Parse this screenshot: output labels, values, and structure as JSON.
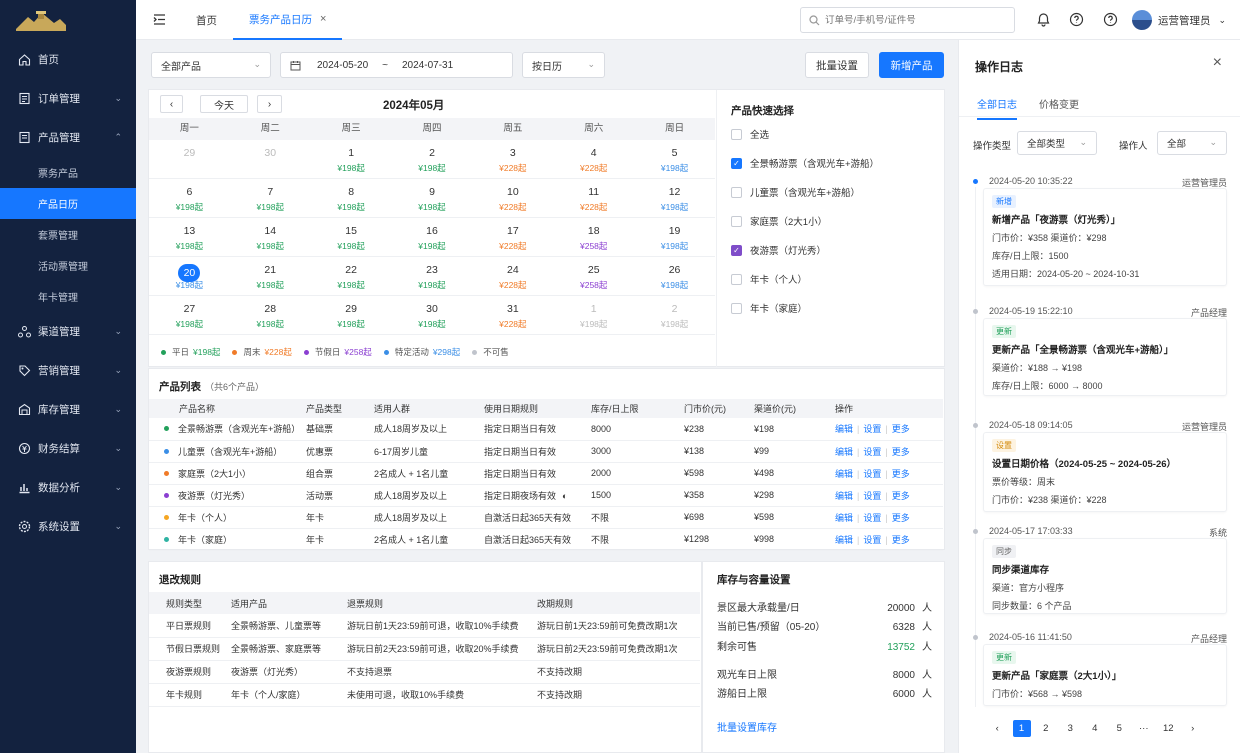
{
  "colors": {
    "accent": "#1677ff",
    "weekday": "#22a05b",
    "weekend": "#f07b28",
    "holiday": "#8b3fd1",
    "special": "#3a8ee6",
    "sidebar": "#13223f"
  },
  "sidebar": {
    "items": [
      {
        "label": "首页",
        "icon": "home-icon"
      },
      {
        "label": "订单管理",
        "icon": "order-icon"
      },
      {
        "label": "产品管理",
        "icon": "product-icon"
      }
    ],
    "sub": [
      "票务产品",
      "产品日历",
      "套票管理",
      "活动票管理",
      "年卡管理"
    ],
    "items2": [
      {
        "label": "渠道管理",
        "icon": "channel-icon"
      },
      {
        "label": "营销管理",
        "icon": "marketing-icon"
      },
      {
        "label": "库存管理",
        "icon": "inventory-icon"
      },
      {
        "label": "财务结算",
        "icon": "finance-icon"
      },
      {
        "label": "数据分析",
        "icon": "analytics-icon"
      },
      {
        "label": "系统设置",
        "icon": "settings-icon"
      }
    ]
  },
  "topbar": {
    "tab_home": "首页",
    "tab_active": "票务产品日历",
    "search_placeholder": "订单号/手机号/证件号",
    "user": "运营管理员"
  },
  "toolbar": {
    "product_select": "全部产品",
    "date_from": "2024-05-20",
    "date_sep": "~",
    "date_to": "2024-07-31",
    "view_select": "按日历",
    "batch": "批量设置",
    "add": "新增产品"
  },
  "calendar": {
    "today_btn": "今天",
    "month_title": "2024年05月",
    "weekdays": [
      "周一",
      "周二",
      "周三",
      "周四",
      "周五",
      "周六",
      "周日"
    ],
    "weeks": [
      [
        {
          "d": "29",
          "dim": true
        },
        {
          "d": "30",
          "dim": true
        },
        {
          "d": "1",
          "p": "¥198起",
          "t": "weekday"
        },
        {
          "d": "2",
          "p": "¥198起",
          "t": "weekday"
        },
        {
          "d": "3",
          "p": "¥228起",
          "t": "weekend"
        },
        {
          "d": "4",
          "p": "¥228起",
          "t": "weekend"
        },
        {
          "d": "5",
          "p": "¥198起",
          "t": "special"
        }
      ],
      [
        {
          "d": "6",
          "p": "¥198起",
          "t": "weekday"
        },
        {
          "d": "7",
          "p": "¥198起",
          "t": "weekday"
        },
        {
          "d": "8",
          "p": "¥198起",
          "t": "weekday"
        },
        {
          "d": "9",
          "p": "¥198起",
          "t": "weekday"
        },
        {
          "d": "10",
          "p": "¥228起",
          "t": "weekend"
        },
        {
          "d": "11",
          "p": "¥228起",
          "t": "weekend"
        },
        {
          "d": "12",
          "p": "¥198起",
          "t": "special"
        }
      ],
      [
        {
          "d": "13",
          "p": "¥198起",
          "t": "weekday"
        },
        {
          "d": "14",
          "p": "¥198起",
          "t": "weekday"
        },
        {
          "d": "15",
          "p": "¥198起",
          "t": "weekday"
        },
        {
          "d": "16",
          "p": "¥198起",
          "t": "weekday"
        },
        {
          "d": "17",
          "p": "¥228起",
          "t": "weekend"
        },
        {
          "d": "18",
          "p": "¥258起",
          "t": "holiday"
        },
        {
          "d": "19",
          "p": "¥198起",
          "t": "special"
        }
      ],
      [
        {
          "d": "20",
          "p": "¥198起",
          "t": "special",
          "today": true
        },
        {
          "d": "21",
          "p": "¥198起",
          "t": "weekday"
        },
        {
          "d": "22",
          "p": "¥198起",
          "t": "weekday"
        },
        {
          "d": "23",
          "p": "¥198起",
          "t": "weekday"
        },
        {
          "d": "24",
          "p": "¥228起",
          "t": "weekend"
        },
        {
          "d": "25",
          "p": "¥258起",
          "t": "holiday"
        },
        {
          "d": "26",
          "p": "¥198起",
          "t": "special"
        }
      ],
      [
        {
          "d": "27",
          "p": "¥198起",
          "t": "weekday"
        },
        {
          "d": "28",
          "p": "¥198起",
          "t": "weekday"
        },
        {
          "d": "29",
          "p": "¥198起",
          "t": "weekday"
        },
        {
          "d": "30",
          "p": "¥198起",
          "t": "weekday"
        },
        {
          "d": "31",
          "p": "¥228起",
          "t": "weekend"
        },
        {
          "d": "1",
          "p": "¥198起",
          "dim": true
        },
        {
          "d": "2",
          "p": "¥198起",
          "dim": true
        }
      ]
    ],
    "legend": [
      {
        "label": "平日",
        "price": "¥198起",
        "color": "#22a05b"
      },
      {
        "label": "周末",
        "price": "¥228起",
        "color": "#f07b28"
      },
      {
        "label": "节假日",
        "price": "¥258起",
        "color": "#8b3fd1"
      },
      {
        "label": "特定活动",
        "price": "¥298起",
        "color": "#3a8ee6"
      },
      {
        "label": "不可售",
        "price": "",
        "color": "#c0c4cc"
      }
    ]
  },
  "quick": {
    "title": "产品快速选择",
    "items": [
      {
        "label": "全选",
        "state": "off"
      },
      {
        "label": "全景畅游票（含观光车+游船）",
        "state": "on"
      },
      {
        "label": "儿童票（含观光车+游船）",
        "state": "off"
      },
      {
        "label": "家庭票（2大1小）",
        "state": "off"
      },
      {
        "label": "夜游票（灯光秀）",
        "state": "on2"
      },
      {
        "label": "年卡（个人）",
        "state": "off"
      },
      {
        "label": "年卡（家庭）",
        "state": "off"
      }
    ]
  },
  "products": {
    "title": "产品列表",
    "count": "（共6个产品）",
    "headers": [
      "产品名称",
      "产品类型",
      "适用人群",
      "使用日期规则",
      "库存/日上限",
      "门市价(元)",
      "渠道价(元)",
      "操作"
    ],
    "ops": [
      "编辑",
      "设置",
      "更多"
    ],
    "rows": [
      {
        "color": "#22a05b",
        "name": "全景畅游票（含观光车+游船）",
        "type": "基础票",
        "crowd": "成人18周岁及以上",
        "rule": "指定日期当日有效",
        "stock": "8000",
        "retail": "¥238",
        "channel": "¥198"
      },
      {
        "color": "#3a8ee6",
        "name": "儿童票（含观光车+游船）",
        "type": "优惠票",
        "crowd": "6-17周岁儿童",
        "rule": "指定日期当日有效",
        "stock": "3000",
        "retail": "¥138",
        "channel": "¥99"
      },
      {
        "color": "#f07b28",
        "name": "家庭票（2大1小）",
        "type": "组合票",
        "crowd": "2名成人 + 1名儿童",
        "rule": "指定日期当日有效",
        "stock": "2000",
        "retail": "¥598",
        "channel": "¥498"
      },
      {
        "color": "#8b3fd1",
        "name": "夜游票（灯光秀）",
        "type": "活动票",
        "crowd": "成人18周岁及以上",
        "rule": "指定日期夜场有效",
        "stock": "1500",
        "retail": "¥358",
        "channel": "¥298",
        "moon": true
      },
      {
        "color": "#f5a623",
        "name": "年卡（个人）",
        "type": "年卡",
        "crowd": "成人18周岁及以上",
        "rule": "自激活日起365天有效",
        "stock": "不限",
        "retail": "¥698",
        "channel": "¥598"
      },
      {
        "color": "#2fb3a3",
        "name": "年卡（家庭）",
        "type": "年卡",
        "crowd": "2名成人 + 1名儿童",
        "rule": "自激活日起365天有效",
        "stock": "不限",
        "retail": "¥1298",
        "channel": "¥998"
      }
    ]
  },
  "refund": {
    "title": "退改规则",
    "headers": [
      "规则类型",
      "适用产品",
      "退票规则",
      "改期规则"
    ],
    "rows": [
      [
        "平日票规则",
        "全景畅游票、儿童票等",
        "游玩日前1天23:59前可退，收取10%手续费",
        "游玩日前1天23:59前可免费改期1次"
      ],
      [
        "节假日票规则",
        "全景畅游票、家庭票等",
        "游玩日前2天23:59前可退，收取20%手续费",
        "游玩日前2天23:59前可免费改期1次"
      ],
      [
        "夜游票规则",
        "夜游票（灯光秀）",
        "不支持退票",
        "不支持改期"
      ],
      [
        "年卡规则",
        "年卡（个人/家庭）",
        "未使用可退，收取10%手续费",
        "不支持改期"
      ]
    ]
  },
  "inventory": {
    "title": "库存与容量设置",
    "link": "批量设置库存",
    "rows": [
      {
        "label": "景区最大承载量/日",
        "value": "20000",
        "unit": "人"
      },
      {
        "label": "当前已售/预留（05-20）",
        "value": "6328",
        "unit": "人"
      },
      {
        "label": "剩余可售",
        "value": "13752",
        "unit": "人",
        "green": true
      },
      {
        "label": "观光车日上限",
        "value": "8000",
        "unit": "人"
      },
      {
        "label": "游船日上限",
        "value": "6000",
        "unit": "人"
      }
    ]
  },
  "log": {
    "title": "操作日志",
    "tabs": [
      "全部日志",
      "价格变更"
    ],
    "type_label": "操作类型",
    "type_value": "全部类型",
    "op_label": "操作人",
    "op_value": "全部",
    "entries": [
      {
        "time": "2024-05-20 10:35:22",
        "who": "运营管理员",
        "badge": "新增",
        "bcolor": "#1677ff",
        "bbg": "#e8f1ff",
        "title": "新增产品「夜游票（灯光秀）」",
        "lines": [
          "门市价：¥358    渠道价：¥298",
          "库存/日上限：1500",
          "适用日期：2024-05-20 ~ 2024-10-31"
        ],
        "active": true
      },
      {
        "time": "2024-05-19 15:22:10",
        "who": "产品经理",
        "badge": "更新",
        "bcolor": "#22a05b",
        "bbg": "#e8f7ee",
        "title": "更新产品「全景畅游票（含观光车+游船）」",
        "lines": [
          "渠道价：¥188 → ¥198",
          "库存/日上限：6000 → 8000"
        ]
      },
      {
        "time": "2024-05-18 09:14:05",
        "who": "运营管理员",
        "badge": "设置",
        "bcolor": "#d48a0b",
        "bbg": "#fdf3e1",
        "title": "设置日期价格（2024-05-25 ~ 2024-05-26）",
        "lines": [
          "票价等级：周末",
          "门市价：¥238    渠道价：¥228"
        ]
      },
      {
        "time": "2024-05-17 17:03:33",
        "who": "系统",
        "badge": "同步",
        "bcolor": "#666",
        "bbg": "#f0f1f4",
        "title": "同步渠道库存",
        "lines": [
          "渠道：官方小程序",
          "同步数量：6 个产品"
        ]
      },
      {
        "time": "2024-05-16 11:41:50",
        "who": "产品经理",
        "badge": "更新",
        "bcolor": "#22a05b",
        "bbg": "#e8f7ee",
        "title": "更新产品「家庭票（2大1小）」",
        "lines": [
          "门市价：¥568 → ¥598"
        ]
      }
    ],
    "pages": [
      "1",
      "2",
      "3",
      "4",
      "5",
      "···",
      "12"
    ]
  }
}
